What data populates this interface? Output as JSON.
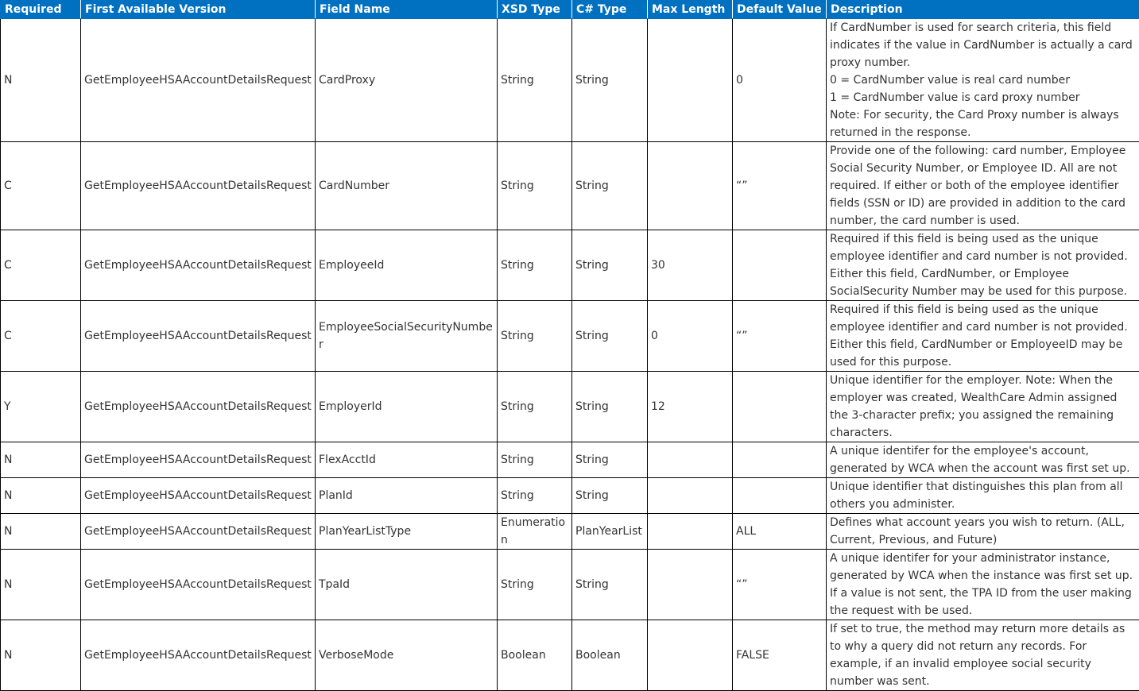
{
  "headers": [
    "Required",
    "First Available Version",
    "Field Name",
    "XSD Type",
    "C# Type",
    "Max Length",
    "Default Value",
    "Description"
  ],
  "rows": [
    {
      "required": "N",
      "version": "GetEmployeeHSAAccountDetailsRequest",
      "field": "CardProxy",
      "xsd": "String",
      "csharp": "String",
      "maxlen": "",
      "default": "0",
      "description": [
        "If CardNumber is used for search criteria, this field indicates if the value in CardNumber is actually a card proxy number.",
        "0 = CardNumber value is real card number",
        "1 = CardNumber value is card proxy number",
        "Note: For security, the Card Proxy number is always returned in the response."
      ]
    },
    {
      "required": "C",
      "version": "GetEmployeeHSAAccountDetailsRequest",
      "field": "CardNumber",
      "xsd": "String",
      "csharp": "String",
      "maxlen": "",
      "default": "“”",
      "description": [
        "Provide one of the following: card number, Employee Social Security Number, or Employee ID. All are not required. If either or both of the employee identifier fields (SSN or ID) are provided in addition to the card number, the card number is used."
      ]
    },
    {
      "required": "C",
      "version": "GetEmployeeHSAAccountDetailsRequest",
      "field": "EmployeeId",
      "xsd": "String",
      "csharp": "String",
      "maxlen": "30",
      "default": "",
      "description": [
        "Required if this field is being used as the unique employee identifier and card number is not provided. Either this field, CardNumber, or Employee SocialSecurity Number may be used for this purpose."
      ]
    },
    {
      "required": "C",
      "version": "GetEmployeeHSAAccountDetailsRequest",
      "field": "EmployeeSocialSecurityNumber",
      "xsd": "String",
      "csharp": "String",
      "maxlen": "0",
      "default": "“”",
      "description": [
        "Required if this field is being used as the unique employee identifier and card number is not provided. Either this field, CardNumber or EmployeeID may be used for this purpose."
      ]
    },
    {
      "required": "Y",
      "version": "GetEmployeeHSAAccountDetailsRequest",
      "field": "EmployerId",
      "xsd": "String",
      "csharp": "String",
      "maxlen": "12",
      "default": "",
      "description": [
        "Unique identifier for the employer. Note: When the employer was created, WealthCare Admin assigned the 3-character prefix; you assigned the remaining characters."
      ]
    },
    {
      "required": "N",
      "version": "GetEmployeeHSAAccountDetailsRequest",
      "field": "FlexAcctId",
      "xsd": "String",
      "csharp": "String",
      "maxlen": "",
      "default": "",
      "description": [
        "A unique identifer for the employee's account, generated by WCA when the account was first set up."
      ]
    },
    {
      "required": "N",
      "version": "GetEmployeeHSAAccountDetailsRequest",
      "field": "PlanId",
      "xsd": "String",
      "csharp": "String",
      "maxlen": "",
      "default": "",
      "description": [
        "Unique identifier that distinguishes this plan from all others you administer."
      ]
    },
    {
      "required": "N",
      "version": "GetEmployeeHSAAccountDetailsRequest",
      "field": "PlanYearListType",
      "xsd": "Enumeration",
      "csharp": "PlanYearList",
      "maxlen": "",
      "default": "ALL",
      "description": [
        "Defines what account years you wish to return. (ALL, Current, Previous, and Future)"
      ]
    },
    {
      "required": "N",
      "version": "GetEmployeeHSAAccountDetailsRequest",
      "field": "TpaId",
      "xsd": "String",
      "csharp": "String",
      "maxlen": "",
      "default": "“”",
      "description": [
        "A unique identifer for your administrator instance, generated by WCA when the instance was first set up. If a value is not sent, the TPA ID from the user making the request with be used."
      ]
    },
    {
      "required": "N",
      "version": "GetEmployeeHSAAccountDetailsRequest",
      "field": "VerboseMode",
      "xsd": "Boolean",
      "csharp": "Boolean",
      "maxlen": "",
      "default": "FALSE",
      "description": [
        "If set to true, the method may return more details as to why a query did not return any records. For example, if an invalid employee social security number was sent."
      ]
    }
  ]
}
